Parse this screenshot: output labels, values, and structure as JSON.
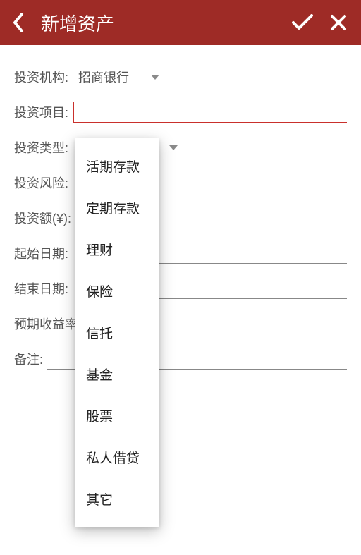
{
  "header": {
    "title": "新增资产"
  },
  "form": {
    "institution": {
      "label": "投资机构:",
      "value": "招商银行"
    },
    "project": {
      "label": "投资项目:"
    },
    "type": {
      "label": "投资类型:"
    },
    "risk": {
      "label": "投资风险:"
    },
    "amount": {
      "label": "投资额(¥):"
    },
    "start": {
      "label": "起始日期:"
    },
    "end": {
      "label": "结束日期:"
    },
    "yield": {
      "label": "预期收益率"
    },
    "remark": {
      "label": "备注:"
    }
  },
  "dropdown": {
    "items": [
      "活期存款",
      "定期存款",
      "理财",
      "保险",
      "信托",
      "基金",
      "股票",
      "私人借贷",
      "其它"
    ]
  }
}
